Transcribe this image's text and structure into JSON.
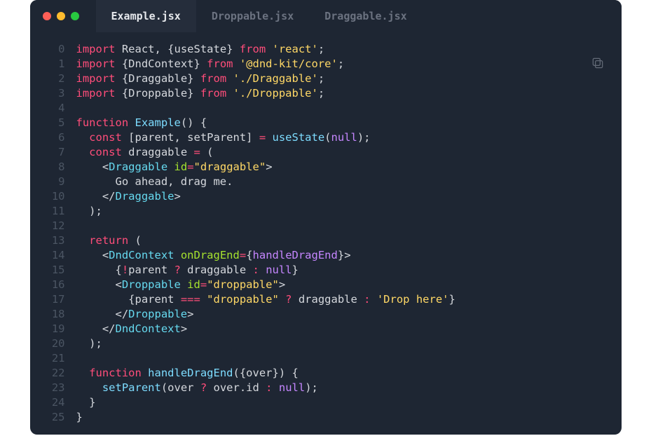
{
  "tabs": [
    {
      "label": "Example.jsx",
      "active": true
    },
    {
      "label": "Droppable.jsx",
      "active": false
    },
    {
      "label": "Draggable.jsx",
      "active": false
    }
  ],
  "copy_icon": "copy",
  "gutter_start": 0,
  "gutter_end": 25,
  "code_lines": [
    [
      [
        "kw",
        "import"
      ],
      [
        "punc",
        " React"
      ],
      [
        "punc",
        ", {"
      ],
      [
        "punc",
        "useState"
      ],
      [
        "punc",
        "} "
      ],
      [
        "kw",
        "from"
      ],
      [
        "punc",
        " "
      ],
      [
        "str",
        "'react'"
      ],
      [
        "punc",
        ";"
      ]
    ],
    [
      [
        "kw",
        "import"
      ],
      [
        "punc",
        " {DndContext} "
      ],
      [
        "kw",
        "from"
      ],
      [
        "punc",
        " "
      ],
      [
        "str",
        "'@dnd-kit/core'"
      ],
      [
        "punc",
        ";"
      ]
    ],
    [
      [
        "kw",
        "import"
      ],
      [
        "punc",
        " {Draggable} "
      ],
      [
        "kw",
        "from"
      ],
      [
        "punc",
        " "
      ],
      [
        "str",
        "'./Draggable'"
      ],
      [
        "punc",
        ";"
      ]
    ],
    [
      [
        "kw",
        "import"
      ],
      [
        "punc",
        " {Droppable} "
      ],
      [
        "kw",
        "from"
      ],
      [
        "punc",
        " "
      ],
      [
        "str",
        "'./Droppable'"
      ],
      [
        "punc",
        ";"
      ]
    ],
    [],
    [
      [
        "kw",
        "function"
      ],
      [
        "punc",
        " "
      ],
      [
        "class",
        "Example"
      ],
      [
        "punc",
        "() {"
      ]
    ],
    [
      [
        "punc",
        "  "
      ],
      [
        "kw",
        "const"
      ],
      [
        "punc",
        " [parent, setParent] "
      ],
      [
        "op",
        "="
      ],
      [
        "punc",
        " "
      ],
      [
        "class",
        "useState"
      ],
      [
        "punc",
        "("
      ],
      [
        "null",
        "null"
      ],
      [
        "punc",
        ");"
      ]
    ],
    [
      [
        "punc",
        "  "
      ],
      [
        "kw",
        "const"
      ],
      [
        "punc",
        " draggable "
      ],
      [
        "op",
        "="
      ],
      [
        "punc",
        " ("
      ]
    ],
    [
      [
        "punc",
        "    <"
      ],
      [
        "comp",
        "Draggable"
      ],
      [
        "punc",
        " "
      ],
      [
        "attr",
        "id"
      ],
      [
        "op",
        "="
      ],
      [
        "str",
        "\"draggable\""
      ],
      [
        "punc",
        ">"
      ]
    ],
    [
      [
        "punc",
        "      Go ahead, drag me."
      ]
    ],
    [
      [
        "punc",
        "    </"
      ],
      [
        "comp",
        "Draggable"
      ],
      [
        "punc",
        ">"
      ]
    ],
    [
      [
        "punc",
        "  );"
      ]
    ],
    [],
    [
      [
        "punc",
        "  "
      ],
      [
        "kw",
        "return"
      ],
      [
        "punc",
        " ("
      ]
    ],
    [
      [
        "punc",
        "    <"
      ],
      [
        "comp",
        "DndContext"
      ],
      [
        "punc",
        " "
      ],
      [
        "attr",
        "onDragEnd"
      ],
      [
        "op",
        "="
      ],
      [
        "punc",
        "{"
      ],
      [
        "null",
        "handleDragEnd"
      ],
      [
        "punc",
        "}>"
      ]
    ],
    [
      [
        "punc",
        "      {"
      ],
      [
        "op",
        "!"
      ],
      [
        "punc",
        "parent "
      ],
      [
        "op",
        "?"
      ],
      [
        "punc",
        " draggable "
      ],
      [
        "op",
        ":"
      ],
      [
        "punc",
        " "
      ],
      [
        "null",
        "null"
      ],
      [
        "punc",
        "}"
      ]
    ],
    [
      [
        "punc",
        "      <"
      ],
      [
        "comp",
        "Droppable"
      ],
      [
        "punc",
        " "
      ],
      [
        "attr",
        "id"
      ],
      [
        "op",
        "="
      ],
      [
        "str",
        "\"droppable\""
      ],
      [
        "punc",
        ">"
      ]
    ],
    [
      [
        "punc",
        "        {parent "
      ],
      [
        "op",
        "==="
      ],
      [
        "punc",
        " "
      ],
      [
        "str",
        "\"droppable\""
      ],
      [
        "punc",
        " "
      ],
      [
        "op",
        "?"
      ],
      [
        "punc",
        " draggable "
      ],
      [
        "op",
        ":"
      ],
      [
        "punc",
        " "
      ],
      [
        "str",
        "'Drop here'"
      ],
      [
        "punc",
        "}"
      ]
    ],
    [
      [
        "punc",
        "      </"
      ],
      [
        "comp",
        "Droppable"
      ],
      [
        "punc",
        ">"
      ]
    ],
    [
      [
        "punc",
        "    </"
      ],
      [
        "comp",
        "DndContext"
      ],
      [
        "punc",
        ">"
      ]
    ],
    [
      [
        "punc",
        "  );"
      ]
    ],
    [],
    [
      [
        "punc",
        "  "
      ],
      [
        "kw",
        "function"
      ],
      [
        "punc",
        " "
      ],
      [
        "class",
        "handleDragEnd"
      ],
      [
        "punc",
        "({over}) {"
      ]
    ],
    [
      [
        "punc",
        "    "
      ],
      [
        "class",
        "setParent"
      ],
      [
        "punc",
        "(over "
      ],
      [
        "op",
        "?"
      ],
      [
        "punc",
        " over.id "
      ],
      [
        "op",
        ":"
      ],
      [
        "punc",
        " "
      ],
      [
        "null",
        "null"
      ],
      [
        "punc",
        ");"
      ]
    ],
    [
      [
        "punc",
        "  }"
      ]
    ],
    [
      [
        "punc",
        "}"
      ]
    ]
  ]
}
